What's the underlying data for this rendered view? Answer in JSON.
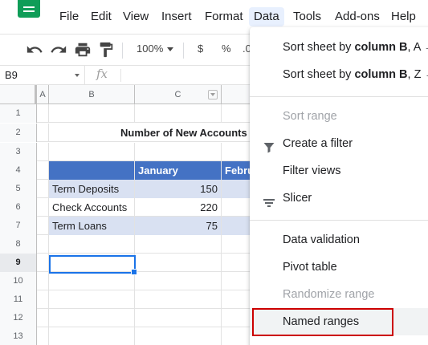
{
  "menubar": {
    "items": [
      "File",
      "Edit",
      "View",
      "Insert",
      "Format",
      "Data",
      "Tools",
      "Add-ons",
      "Help"
    ]
  },
  "toolbar": {
    "zoom": "100%",
    "currency": "$",
    "percent": "%",
    "decimal": ".0"
  },
  "formula_bar": {
    "name_box": "B9",
    "fx": "fx"
  },
  "grid": {
    "columns": [
      "A",
      "B",
      "C",
      "Febru"
    ],
    "rows": [
      "1",
      "2",
      "3",
      "4",
      "5",
      "6",
      "7",
      "8",
      "9",
      "10",
      "11",
      "12",
      "13"
    ],
    "title": "Number of New Accounts",
    "header": {
      "b": "",
      "c": "January",
      "d": "Febru"
    },
    "data": [
      {
        "label": "Term Deposits",
        "value": "150"
      },
      {
        "label": "Check Accounts",
        "value": "220"
      },
      {
        "label": "Term Loans",
        "value": "75"
      }
    ]
  },
  "data_menu": {
    "sort_asc_prefix": "Sort sheet by ",
    "sort_asc_bold": "column B",
    "sort_asc_suffix": ", A →",
    "sort_desc_prefix": "Sort sheet by ",
    "sort_desc_bold": "column B",
    "sort_desc_suffix": ", Z →",
    "sort_range": "Sort range",
    "create_filter": "Create a filter",
    "filter_views": "Filter views",
    "slicer": "Slicer",
    "data_validation": "Data validation",
    "pivot_table": "Pivot table",
    "randomize_range": "Randomize range",
    "named_ranges": "Named ranges"
  },
  "colors": {
    "header_fill": "#4472c4",
    "band_fill": "#d9e1f2",
    "selection": "#1a73e8",
    "highlight": "#cc0000",
    "brand": "#0f9d58"
  }
}
